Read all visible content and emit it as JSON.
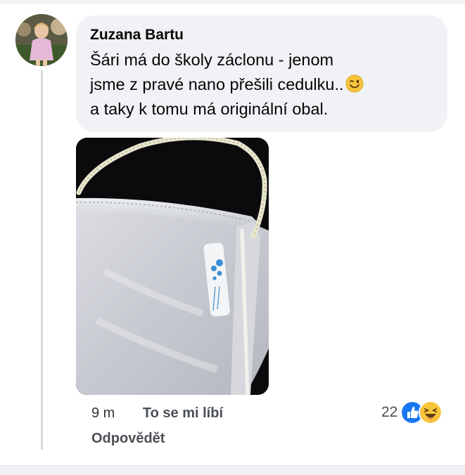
{
  "comment": {
    "author": "Zuzana Bartu",
    "text_lines": [
      "Šári má do školy záclonu - jenom",
      "jsme z pravé nano přešili cedulku..",
      "a taky k tomu má originální obal."
    ],
    "inline_emoji": "winking-face",
    "time": "9 m",
    "like_label": "To se mi líbí",
    "reply_label": "Odpovědět",
    "reaction_count": "22",
    "reaction_icons": [
      "like-icon",
      "haha-icon"
    ]
  },
  "colors": {
    "bubble": "#f0f2f5",
    "like_blue": "#1877f2",
    "haha_yellow": "#f7c43b",
    "meta_text": "#65676b"
  }
}
